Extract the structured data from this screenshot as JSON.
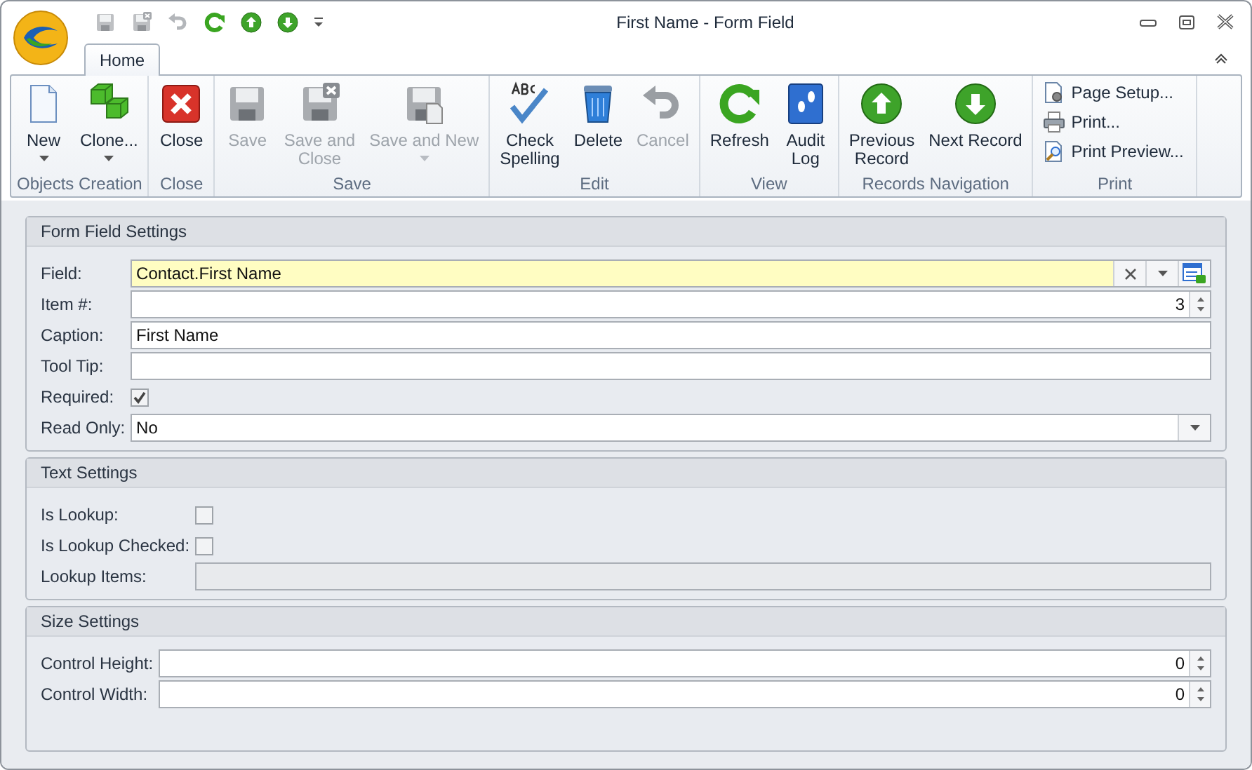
{
  "window": {
    "title": "First Name - Form Field"
  },
  "quick_access": [
    {
      "kind": "save",
      "disabled": true
    },
    {
      "kind": "save-close",
      "disabled": true
    },
    {
      "kind": "undo",
      "disabled": true
    },
    {
      "kind": "refresh",
      "disabled": false
    },
    {
      "kind": "up",
      "disabled": false
    },
    {
      "kind": "down",
      "disabled": false
    },
    {
      "kind": "customize",
      "disabled": false
    }
  ],
  "tabs": [
    {
      "label": "Home",
      "selected": true
    }
  ],
  "ribbon_groups": [
    {
      "label": "Objects Creation",
      "buttons": [
        {
          "kind": "new",
          "label": "New",
          "dropdown": true,
          "disabled": false
        },
        {
          "kind": "clone",
          "label": "Clone...",
          "dropdown": true,
          "disabled": false
        }
      ]
    },
    {
      "label": "Close",
      "buttons": [
        {
          "kind": "close",
          "label": "Close",
          "dropdown": false,
          "disabled": false
        }
      ]
    },
    {
      "label": "Save",
      "buttons": [
        {
          "kind": "save",
          "label": "Save",
          "dropdown": false,
          "disabled": true
        },
        {
          "kind": "save-close",
          "label": "Save and\nClose",
          "dropdown": false,
          "disabled": true
        },
        {
          "kind": "save-new",
          "label": "Save and New",
          "dropdown": true,
          "disabled": true
        }
      ]
    },
    {
      "label": "Edit",
      "buttons": [
        {
          "kind": "spell",
          "label": "Check\nSpelling",
          "dropdown": false,
          "disabled": false
        },
        {
          "kind": "delete",
          "label": "Delete",
          "dropdown": false,
          "disabled": false
        },
        {
          "kind": "cancel",
          "label": "Cancel",
          "dropdown": false,
          "disabled": true
        }
      ]
    },
    {
      "label": "View",
      "buttons": [
        {
          "kind": "refresh",
          "label": "Refresh",
          "dropdown": false,
          "disabled": false
        },
        {
          "kind": "audit",
          "label": "Audit\nLog",
          "dropdown": false,
          "disabled": false
        }
      ]
    },
    {
      "label": "Records Navigation",
      "buttons": [
        {
          "kind": "prev",
          "label": "Previous\nRecord",
          "dropdown": false,
          "disabled": false
        },
        {
          "kind": "next",
          "label": "Next Record",
          "dropdown": false,
          "disabled": false
        }
      ]
    },
    {
      "label": "Print",
      "small": [
        {
          "kind": "page-setup",
          "label": "Page Setup..."
        },
        {
          "kind": "print",
          "label": "Print..."
        },
        {
          "kind": "preview",
          "label": "Print Preview..."
        }
      ]
    }
  ],
  "sections": [
    {
      "title": "Form Field Settings",
      "rows": [
        {
          "label": "Field:",
          "kind": "lookup",
          "value": "Contact.First Name"
        },
        {
          "label": "Item #:",
          "kind": "spin",
          "value": "3"
        },
        {
          "label": "Caption:",
          "kind": "text",
          "value": "First Name",
          "disabled": false
        },
        {
          "label": "Tool Tip:",
          "kind": "text",
          "disabled": false
        },
        {
          "label": "Required:",
          "kind": "checkbox",
          "checked": true
        },
        {
          "label": "Read Only:",
          "kind": "combo",
          "value": "No"
        }
      ]
    },
    {
      "title": "Text Settings",
      "rows": [
        {
          "label": "Is Lookup:",
          "kind": "checkbox",
          "checked": false
        },
        {
          "label": "Is Lookup Checked:",
          "kind": "checkbox",
          "checked": false
        },
        {
          "label": "Lookup Items:",
          "kind": "text",
          "disabled": true
        }
      ]
    },
    {
      "title": "Size Settings",
      "rows": [
        {
          "label": "Control Height:",
          "kind": "spin",
          "value": "0"
        },
        {
          "label": "Control Width:",
          "kind": "spin",
          "value": "0"
        }
      ]
    }
  ]
}
